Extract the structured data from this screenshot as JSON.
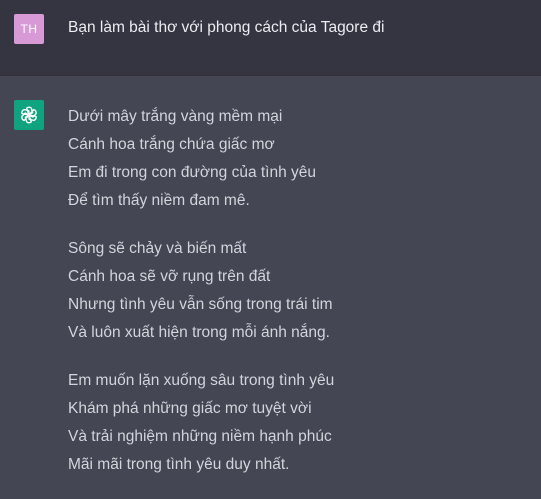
{
  "user": {
    "avatar_initials": "TH",
    "avatar_color": "#d89ad6",
    "message": "Bạn làm bài thơ với phong cách của Tagore đi"
  },
  "assistant": {
    "avatar_icon": "openai-logo-icon",
    "avatar_color": "#10a37f",
    "stanzas": [
      {
        "lines": [
          "Dưới mây trắng vàng mềm mại",
          "Cánh hoa trắng chứa giấc mơ",
          "Em đi trong con đường của tình yêu",
          "Để tìm thấy niềm đam mê."
        ]
      },
      {
        "lines": [
          "Sông sẽ chảy và biến mất",
          "Cánh hoa sẽ vỡ rụng trên đất",
          "Nhưng tình yêu vẫn sống trong trái tim",
          "Và luôn xuất hiện trong mỗi ánh nắng."
        ]
      },
      {
        "lines": [
          "Em muốn lặn xuống sâu trong tình yêu",
          "Khám phá những giấc mơ tuyệt vời",
          "Và trải nghiệm những niềm hạnh phúc",
          "Mãi mãi trong tình yêu duy nhất."
        ]
      }
    ]
  }
}
